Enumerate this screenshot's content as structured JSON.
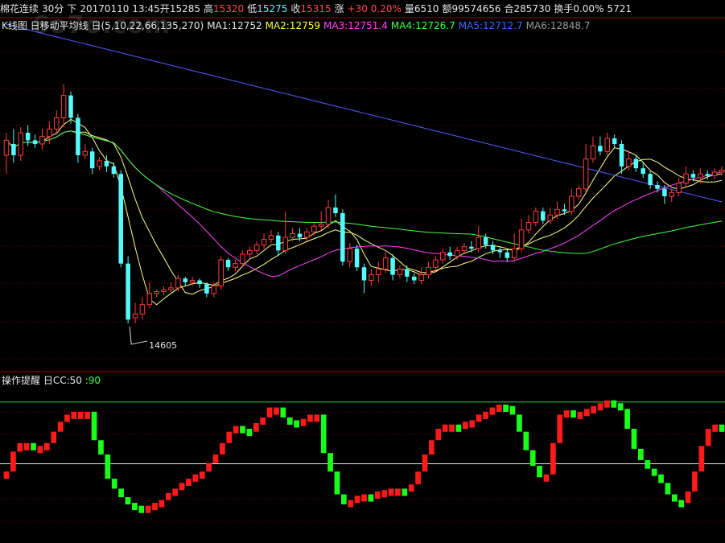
{
  "info": {
    "name": "棉花连续",
    "period": "30分",
    "dir": "下",
    "datetime": "20170110 13:45",
    "open_label": "开",
    "open": "15285",
    "high_label": "高",
    "high": "15320",
    "low_label": "低",
    "low": "15275",
    "close_label": "收",
    "close": "15315",
    "chg_label": "涨",
    "chg": "+30 0.20%",
    "vol": "量6510",
    "amt": "额99574656",
    "oi": "合285730",
    "turnover": "换手0.00%",
    "extra": "5721"
  },
  "ma_legend": {
    "title": "K线图 日移动平均线 日(5,10,22,66,135,270)",
    "ma1": "MA1:12752",
    "ma2": "MA2:12759",
    "ma3": "MA3:12751.4",
    "ma4": "MA4:12726.7",
    "ma5": "MA5:12712.7",
    "ma6": "MA6:12848.7"
  },
  "indicator_legend": {
    "title": "操作提醒 日CC:50",
    "value": ":90"
  },
  "watermark": "6o7o.com",
  "colors": {
    "up": "#ff3c3c",
    "down": "#54fcfc",
    "ma_slow": "#5060ff",
    "ma_mid": "#44ff44",
    "ma_fast1": "#ffff88",
    "ma_fast2": "#ff44ff",
    "ma_gray": "#888888",
    "grid": "#7a0000"
  },
  "chart_data": {
    "type": "candlestick",
    "annotations": [
      "14605"
    ],
    "low_marker": "14605",
    "candles": [
      [
        15500,
        15580,
        15400,
        15620
      ],
      [
        15560,
        15500,
        15460,
        15640
      ],
      [
        15500,
        15620,
        15470,
        15650
      ],
      [
        15620,
        15580,
        15550,
        15660
      ],
      [
        15580,
        15560,
        15540,
        15610
      ],
      [
        15560,
        15600,
        15530,
        15640
      ],
      [
        15600,
        15640,
        15560,
        15680
      ],
      [
        15640,
        15700,
        15610,
        15740
      ],
      [
        15700,
        15820,
        15650,
        15880
      ],
      [
        15820,
        15700,
        15670,
        15840
      ],
      [
        15700,
        15500,
        15460,
        15720
      ],
      [
        15500,
        15520,
        15480,
        15560
      ],
      [
        15520,
        15430,
        15400,
        15540
      ],
      [
        15440,
        15470,
        15420,
        15490
      ],
      [
        15470,
        15440,
        15410,
        15500
      ],
      [
        15440,
        15400,
        15380,
        15460
      ],
      [
        15400,
        14920,
        14900,
        15420
      ],
      [
        14920,
        14620,
        14600,
        14960
      ],
      [
        14630,
        14650,
        14600,
        14710
      ],
      [
        14650,
        14700,
        14620,
        14740
      ],
      [
        14700,
        14760,
        14680,
        14820
      ],
      [
        14760,
        14770,
        14740,
        14780
      ],
      [
        14770,
        14780,
        14750,
        14800
      ],
      [
        14780,
        14790,
        14760,
        14820
      ],
      [
        14790,
        14840,
        14770,
        14860
      ],
      [
        14840,
        14820,
        14800,
        14850
      ],
      [
        14820,
        14830,
        14800,
        14850
      ],
      [
        14830,
        14810,
        14790,
        14840
      ],
      [
        14810,
        14760,
        14740,
        14820
      ],
      [
        14760,
        14800,
        14740,
        14820
      ],
      [
        14800,
        14940,
        14780,
        14960
      ],
      [
        14940,
        14900,
        14880,
        14950
      ],
      [
        14900,
        14920,
        14880,
        14940
      ],
      [
        14920,
        14970,
        14900,
        14990
      ],
      [
        14970,
        14990,
        14950,
        15010
      ],
      [
        14990,
        15020,
        14970,
        15040
      ],
      [
        15020,
        15050,
        15000,
        15080
      ],
      [
        15050,
        15070,
        15030,
        15100
      ],
      [
        15070,
        14990,
        14960,
        15090
      ],
      [
        14990,
        15060,
        14970,
        15200
      ],
      [
        15060,
        15080,
        15040,
        15110
      ],
      [
        15080,
        15060,
        15040,
        15110
      ],
      [
        15060,
        15090,
        15040,
        15110
      ],
      [
        15090,
        15120,
        15070,
        15140
      ],
      [
        15120,
        15130,
        15100,
        15200
      ],
      [
        15130,
        15220,
        15110,
        15260
      ],
      [
        15220,
        15190,
        15170,
        15290
      ],
      [
        15190,
        14930,
        14910,
        15210
      ],
      [
        14930,
        15000,
        14900,
        15030
      ],
      [
        15000,
        14900,
        14880,
        15020
      ],
      [
        14900,
        14830,
        14760,
        14920
      ],
      [
        14830,
        14860,
        14800,
        14890
      ],
      [
        14860,
        14890,
        14820,
        14930
      ],
      [
        14890,
        14950,
        14870,
        14980
      ],
      [
        14950,
        14860,
        14830,
        14970
      ],
      [
        14860,
        14890,
        14840,
        14910
      ],
      [
        14890,
        14850,
        14820,
        14910
      ],
      [
        14850,
        14830,
        14810,
        14870
      ],
      [
        14830,
        14860,
        14810,
        14900
      ],
      [
        14860,
        14900,
        14840,
        14930
      ],
      [
        14900,
        14940,
        14880,
        14960
      ],
      [
        14940,
        14980,
        14920,
        15000
      ],
      [
        14980,
        14960,
        14940,
        15010
      ],
      [
        14960,
        14990,
        14940,
        15010
      ],
      [
        14990,
        15010,
        14970,
        15030
      ],
      [
        15010,
        15000,
        14980,
        15040
      ],
      [
        15000,
        15060,
        14980,
        15120
      ],
      [
        15060,
        15020,
        15000,
        15080
      ],
      [
        15020,
        14990,
        14970,
        15040
      ],
      [
        14990,
        14980,
        14950,
        15010
      ],
      [
        14980,
        14950,
        14930,
        15000
      ],
      [
        14950,
        15000,
        14930,
        15080
      ],
      [
        15000,
        15100,
        14980,
        15160
      ],
      [
        15100,
        15140,
        15080,
        15180
      ],
      [
        15140,
        15200,
        15120,
        15220
      ],
      [
        15200,
        15150,
        15130,
        15220
      ],
      [
        15150,
        15180,
        15130,
        15220
      ],
      [
        15180,
        15210,
        15160,
        15250
      ],
      [
        15210,
        15200,
        15180,
        15240
      ],
      [
        15200,
        15280,
        15180,
        15320
      ],
      [
        15280,
        15320,
        15260,
        15340
      ],
      [
        15320,
        15480,
        15300,
        15560
      ],
      [
        15480,
        15550,
        15460,
        15600
      ],
      [
        15550,
        15520,
        15500,
        15600
      ],
      [
        15520,
        15590,
        15500,
        15620
      ],
      [
        15590,
        15560,
        15540,
        15610
      ],
      [
        15560,
        15440,
        15400,
        15580
      ],
      [
        15440,
        15480,
        15420,
        15520
      ],
      [
        15480,
        15430,
        15410,
        15500
      ],
      [
        15430,
        15400,
        15380,
        15460
      ],
      [
        15400,
        15340,
        15320,
        15420
      ],
      [
        15340,
        15320,
        15300,
        15360
      ],
      [
        15320,
        15280,
        15240,
        15340
      ],
      [
        15280,
        15300,
        15250,
        15320
      ],
      [
        15300,
        15350,
        15280,
        15380
      ],
      [
        15350,
        15400,
        15330,
        15440
      ],
      [
        15400,
        15380,
        15360,
        15420
      ],
      [
        15380,
        15400,
        15350,
        15430
      ],
      [
        15400,
        15390,
        15370,
        15420
      ],
      [
        15390,
        15410,
        15370,
        15430
      ],
      [
        15410,
        15420,
        15390,
        15440
      ]
    ],
    "indicator": {
      "name": "CC",
      "reference_levels": [
        50,
        90
      ],
      "values": [
        40,
        54,
        60,
        60,
        58,
        58,
        60,
        68,
        75,
        80,
        82,
        82,
        82,
        62,
        52,
        35,
        28,
        22,
        18,
        16,
        15,
        16,
        18,
        20,
        25,
        28,
        32,
        35,
        38,
        40,
        46,
        52,
        60,
        68,
        72,
        70,
        68,
        74,
        78,
        85,
        85,
        78,
        76,
        75,
        77,
        80,
        80,
        53,
        40,
        24,
        17,
        20,
        23,
        24,
        23,
        26,
        27,
        28,
        28,
        27,
        31,
        40,
        52,
        62,
        70,
        73,
        73,
        71,
        75,
        76,
        80,
        82,
        85,
        87,
        86,
        80,
        68,
        55,
        44,
        36,
        38,
        60,
        80,
        83,
        82,
        82,
        84,
        86,
        88,
        90,
        88,
        84,
        70,
        56,
        48,
        42,
        38,
        32,
        24,
        20,
        18,
        26,
        40,
        58,
        70,
        73,
        72
      ]
    }
  }
}
